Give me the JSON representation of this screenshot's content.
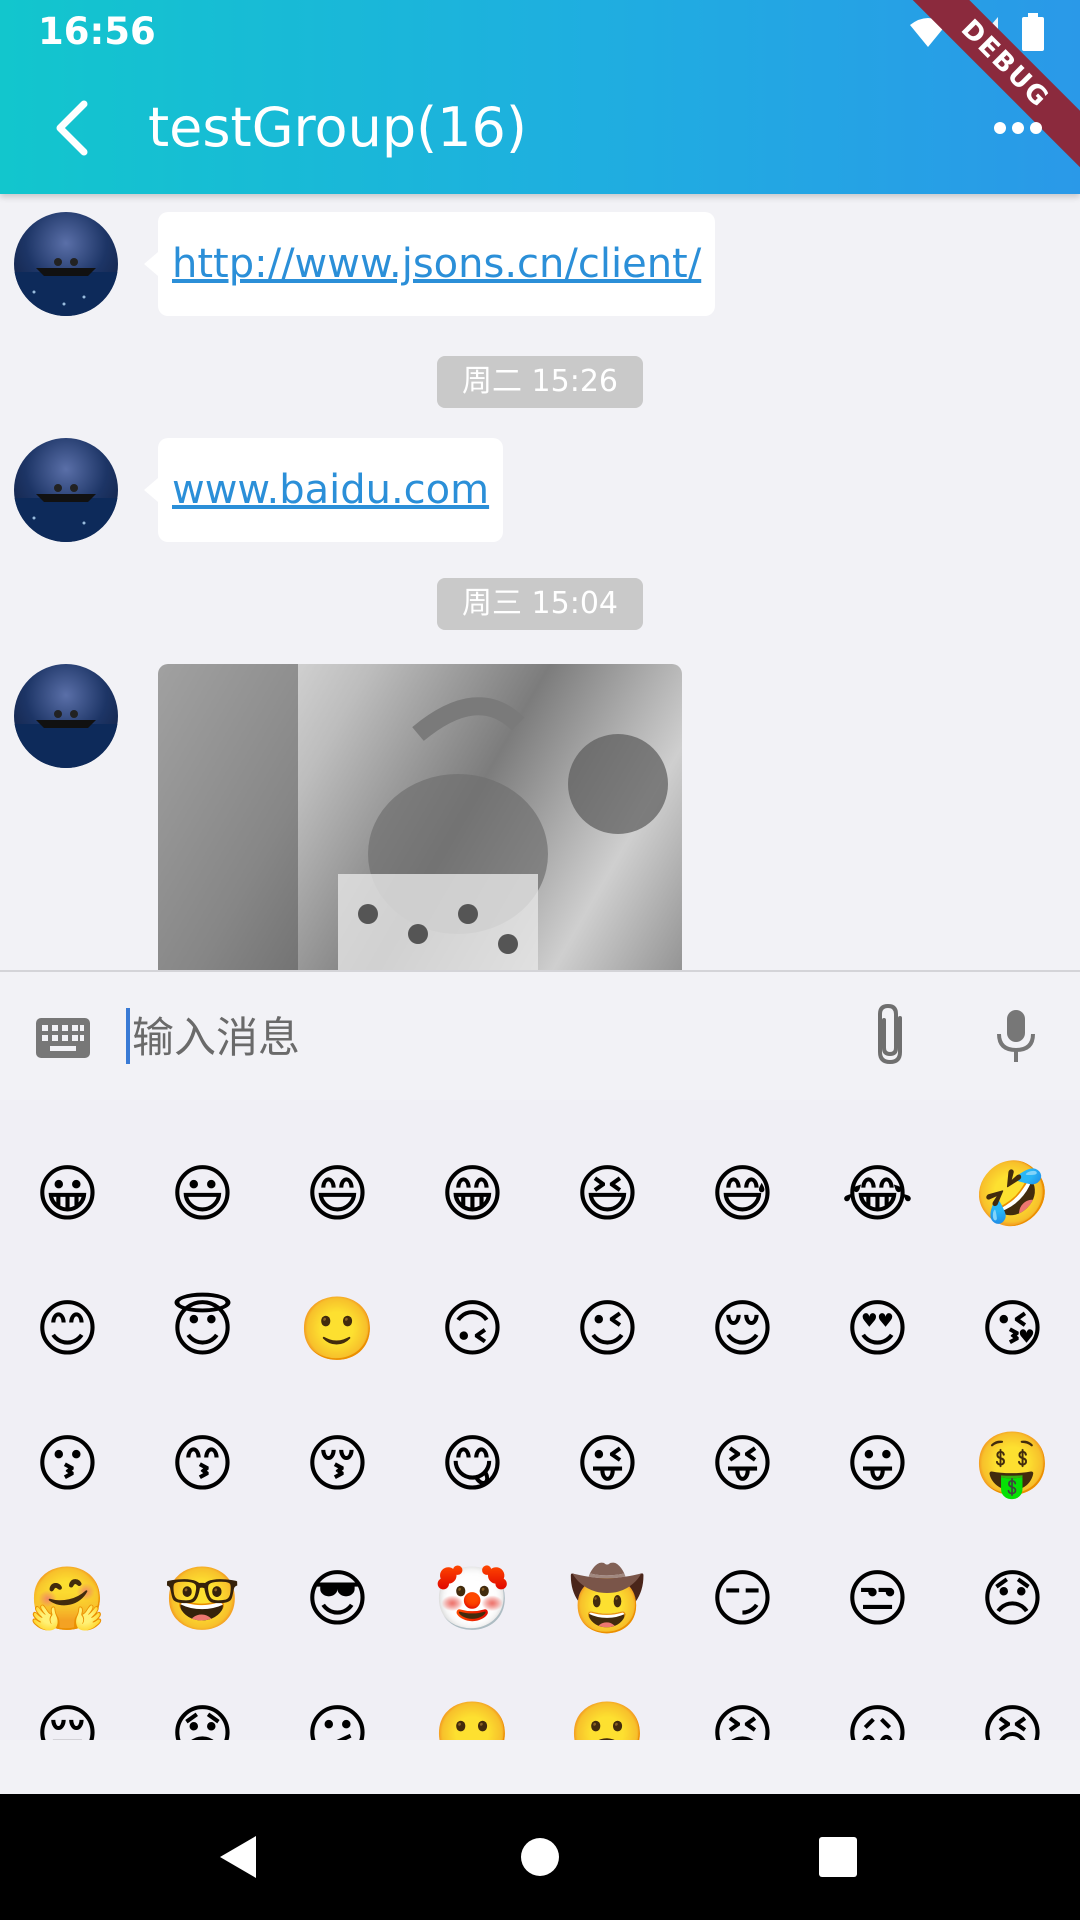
{
  "status_bar": {
    "time": "16:56",
    "debug_label": "DEBUG"
  },
  "header": {
    "title": "testGroup(16)"
  },
  "messages": [
    {
      "type": "text",
      "text": "http://www.jsons.cn/client/"
    },
    {
      "type": "time",
      "text": "周二 15:26"
    },
    {
      "type": "text",
      "text": "www.baidu.com"
    },
    {
      "type": "time",
      "text": "周三 15:04"
    },
    {
      "type": "image"
    }
  ],
  "input": {
    "placeholder": "输入消息"
  },
  "emoji_rows": [
    [
      "😀",
      "😃",
      "😄",
      "😁",
      "😆",
      "😅",
      "😂",
      "🤣"
    ],
    [
      "😊",
      "😇",
      "🙂",
      "🙃",
      "😉",
      "😌",
      "😍",
      "😘"
    ],
    [
      "😗",
      "😙",
      "😚",
      "😋",
      "😜",
      "😝",
      "😛",
      "🤑"
    ],
    [
      "🤗",
      "🤓",
      "😎",
      "🤡",
      "🤠",
      "😏",
      "😒",
      "😞"
    ],
    [
      "😔",
      "😟",
      "😕",
      "🙁",
      "☹️",
      "😣",
      "😖",
      "😫"
    ]
  ],
  "colors": {
    "header_start": "#12c6cd",
    "header_end": "#2a99e8",
    "link": "#2b8fd8",
    "time_chip": "#c9c9c9"
  }
}
